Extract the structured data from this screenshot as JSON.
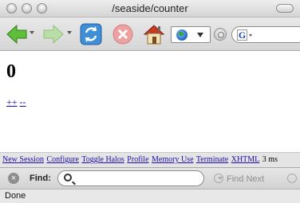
{
  "window": {
    "title": "/seaside/counter"
  },
  "toolbar": {
    "back_icon": "back-arrow-icon",
    "forward_icon": "forward-arrow-icon",
    "reload_icon": "reload-icon",
    "stop_icon": "stop-icon",
    "home_icon": "home-icon",
    "url_value": "",
    "search_engine_glyph": "G",
    "search_value": ""
  },
  "page": {
    "counter_value": "0",
    "increment_label": "++",
    "decrement_label": "--"
  },
  "seaside_toolbar": {
    "links": [
      "New Session",
      "Configure",
      "Toggle Halos",
      "Profile",
      "Memory Use",
      "Terminate",
      "XHTML"
    ],
    "render_time": "3 ms"
  },
  "find_bar": {
    "label": "Find:",
    "input_value": "",
    "find_next_label": "Find Next"
  },
  "status": {
    "text": "Done"
  }
}
